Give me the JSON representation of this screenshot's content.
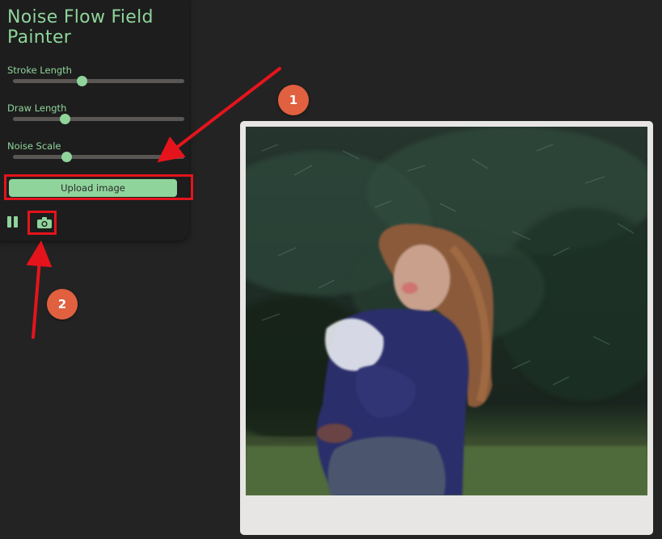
{
  "app": {
    "title": "Noise Flow Field Painter"
  },
  "controls": {
    "sliders": [
      {
        "label": "Stroke Length",
        "value": 0.4
      },
      {
        "label": "Draw Length",
        "value": 0.3
      },
      {
        "label": "Noise Scale",
        "value": 0.31
      }
    ],
    "upload_label": "Upload image",
    "pause_icon": "pause-icon",
    "camera_icon": "camera-icon"
  },
  "annotations": {
    "badge_1": "1",
    "badge_2": "2",
    "highlight_color": "#e5141c",
    "badge_color": "#e0603f"
  },
  "theme": {
    "accent": "#8fd49b",
    "background": "#232323",
    "panel": "#1d1d1d"
  }
}
